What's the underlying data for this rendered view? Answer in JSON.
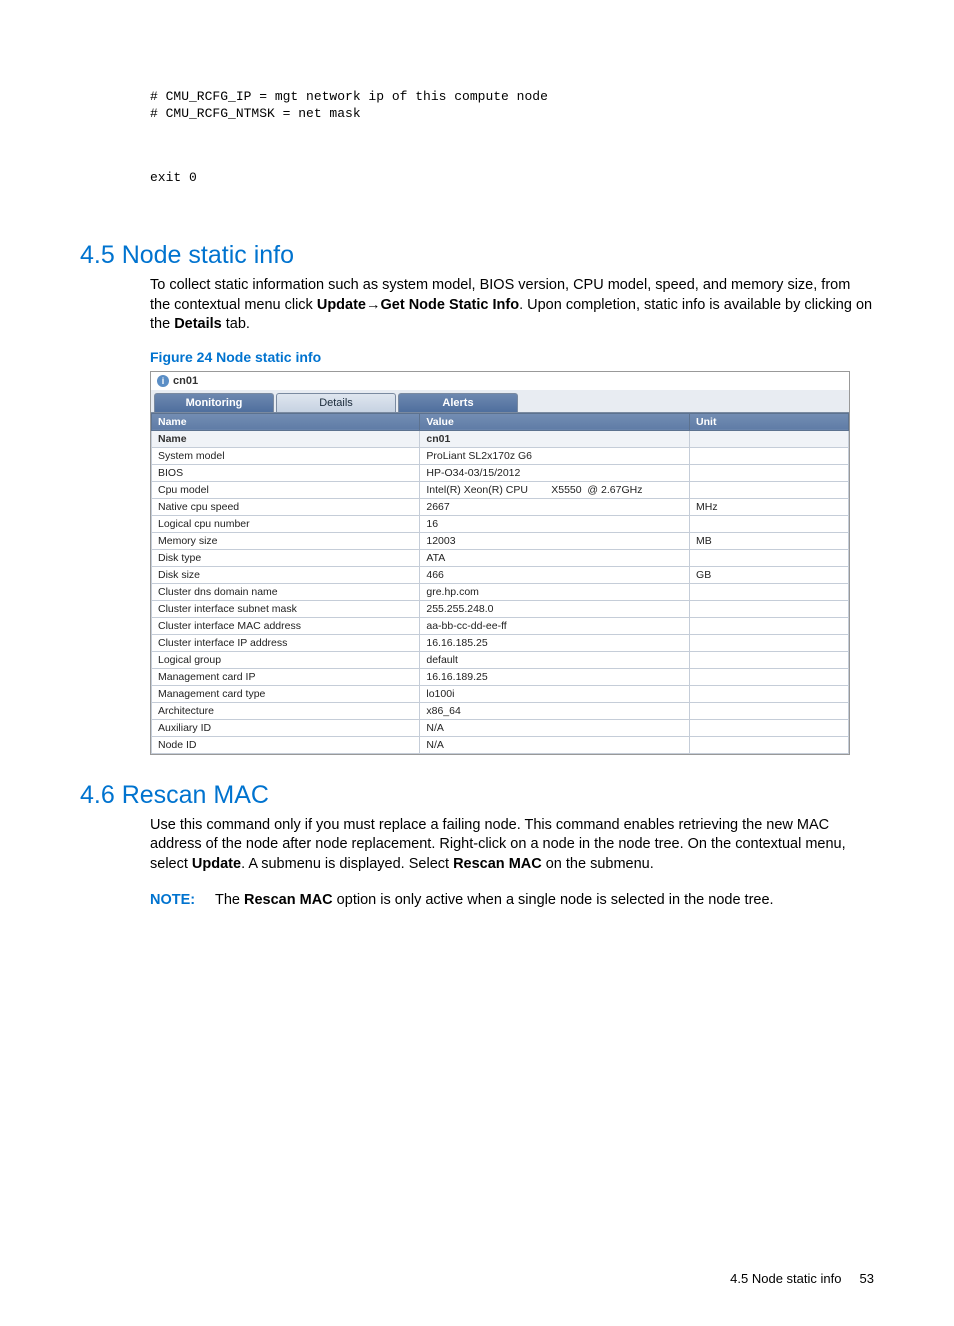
{
  "code": {
    "block1": "# CMU_RCFG_IP = mgt network ip of this compute node\n# CMU_RCFG_NTMSK = net mask",
    "block2": "exit 0"
  },
  "sections": {
    "node_static_info": {
      "heading": "4.5 Node static info",
      "body_pre": "To collect static information such as system model, BIOS version, CPU model, speed, and memory size, from the contextual menu click ",
      "update": "Update",
      "arrow": "→",
      "get_node": "Get Node Static Info",
      "body_mid": ". Upon completion, static info is available by clicking on the ",
      "details": "Details",
      "body_post": " tab.",
      "figure_caption": "Figure 24 Node static info"
    },
    "rescan_mac": {
      "heading": "4.6 Rescan MAC",
      "body_pre": "Use this command only if you must replace a failing node. This command enables retrieving the new MAC address of the node after node replacement. Right-click on a node in the node tree. On the contextual menu, select ",
      "update": "Update",
      "body_mid": ". A submenu is displayed. Select ",
      "rescan": "Rescan MAC",
      "body_post": " on the submenu."
    }
  },
  "note": {
    "label": "NOTE:",
    "pre": "The ",
    "bold": "Rescan MAC",
    "post": " option is only active when a single node is selected in the node tree."
  },
  "figure": {
    "title_node": "cn01",
    "tabs": {
      "monitoring": "Monitoring",
      "details": "Details",
      "alerts": "Alerts"
    },
    "headers": {
      "name": "Name",
      "value": "Value",
      "unit": "Unit"
    },
    "rows": [
      {
        "name": "Name",
        "value": "cn01",
        "unit": ""
      },
      {
        "name": "System model",
        "value": "ProLiant SL2x170z G6",
        "unit": ""
      },
      {
        "name": "BIOS",
        "value": "HP-O34-03/15/2012",
        "unit": ""
      },
      {
        "name": "Cpu model",
        "value": "Intel(R) Xeon(R) CPU        X5550  @ 2.67GHz",
        "unit": ""
      },
      {
        "name": "Native cpu speed",
        "value": "2667",
        "unit": "MHz"
      },
      {
        "name": "Logical cpu number",
        "value": "16",
        "unit": ""
      },
      {
        "name": "Memory size",
        "value": "12003",
        "unit": "MB"
      },
      {
        "name": "Disk type",
        "value": "ATA",
        "unit": ""
      },
      {
        "name": "Disk size",
        "value": "466",
        "unit": "GB"
      },
      {
        "name": "Cluster dns domain name",
        "value": "gre.hp.com",
        "unit": ""
      },
      {
        "name": "Cluster interface subnet mask",
        "value": "255.255.248.0",
        "unit": ""
      },
      {
        "name": "Cluster interface MAC address",
        "value": "aa-bb-cc-dd-ee-ff",
        "unit": ""
      },
      {
        "name": "Cluster interface IP address",
        "value": "16.16.185.25",
        "unit": ""
      },
      {
        "name": "Logical group",
        "value": "default",
        "unit": ""
      },
      {
        "name": "Management card IP",
        "value": "16.16.189.25",
        "unit": ""
      },
      {
        "name": "Management card type",
        "value": "lo100i",
        "unit": ""
      },
      {
        "name": "Architecture",
        "value": "x86_64",
        "unit": ""
      },
      {
        "name": "Auxiliary ID",
        "value": "N/A",
        "unit": ""
      },
      {
        "name": "Node ID",
        "value": "N/A",
        "unit": ""
      }
    ]
  },
  "footer": {
    "title": "4.5 Node static info",
    "page": "53"
  }
}
